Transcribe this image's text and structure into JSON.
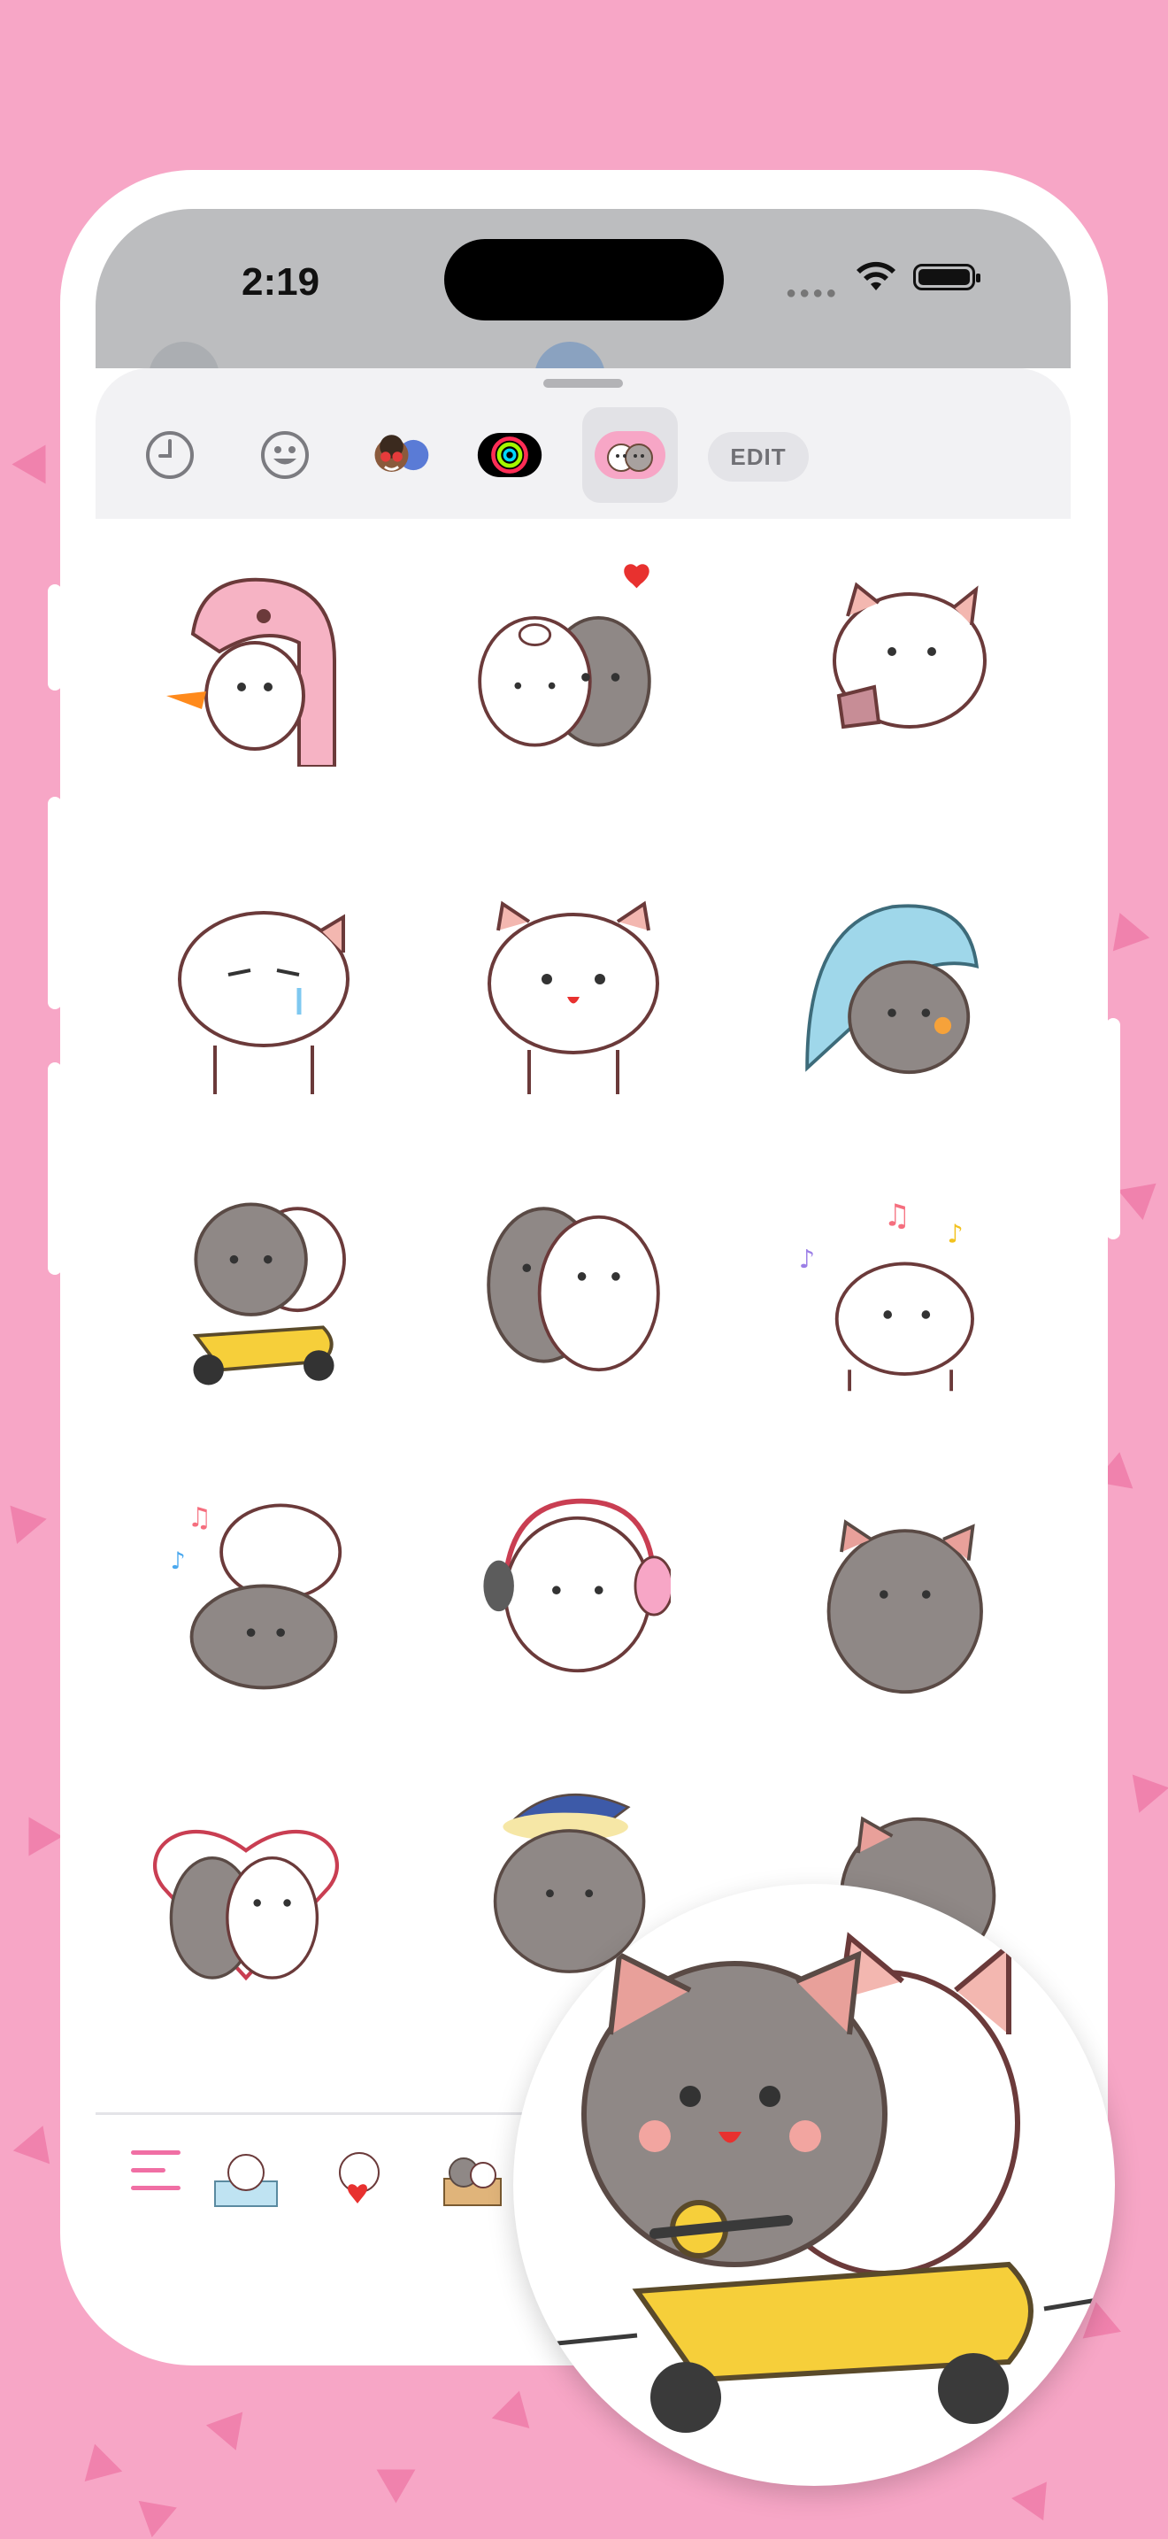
{
  "status_bar": {
    "time": "2:19",
    "signal_icon": "cellular-dots-icon",
    "wifi_icon": "wifi-icon",
    "battery_icon": "battery-icon"
  },
  "sheet": {
    "tabs": [
      {
        "name": "recent",
        "icon": "clock-icon"
      },
      {
        "name": "emoji",
        "icon": "smiley-icon"
      },
      {
        "name": "memoji",
        "icon": "memoji-avatars-icon"
      },
      {
        "name": "activity",
        "icon": "activity-rings-icon"
      },
      {
        "name": "cat-stickers",
        "icon": "cat-sticker-pack-icon",
        "selected": true
      }
    ],
    "edit_label": "EDIT"
  },
  "stickers": [
    {
      "id": "pink-dino-cat-fire",
      "desc_icon": "cat-in-pink-dino-hat-breathing-fire"
    },
    {
      "id": "pig-hood-with-grey-cat",
      "desc_icon": "cats-hugging-heart"
    },
    {
      "id": "white-cat-drinking",
      "desc_icon": "white-cat-drinking"
    },
    {
      "id": "white-cat-crying",
      "desc_icon": "white-cat-crying"
    },
    {
      "id": "white-cat-smiling",
      "desc_icon": "white-cat-smiling"
    },
    {
      "id": "grey-cat-blue-dino",
      "desc_icon": "grey-cat-in-blue-dino-hat"
    },
    {
      "id": "cats-on-scooter",
      "desc_icon": "cats-riding-scooter"
    },
    {
      "id": "cats-hugging",
      "desc_icon": "cats-hugging"
    },
    {
      "id": "white-cat-music",
      "desc_icon": "white-cat-with-music-notes"
    },
    {
      "id": "cats-stacked-music",
      "desc_icon": "cats-stacked-music"
    },
    {
      "id": "white-cat-headphones",
      "desc_icon": "white-cat-with-headphones"
    },
    {
      "id": "grey-cat-waving",
      "desc_icon": "grey-cat-waving"
    },
    {
      "id": "cats-heart-outline",
      "desc_icon": "cats-in-heart"
    },
    {
      "id": "grey-cat-sleep-cap",
      "desc_icon": "grey-cat-sleep-cap"
    },
    {
      "id": "grey-cat-peeking",
      "desc_icon": "grey-cat-peeking"
    }
  ],
  "bottom_bar": {
    "menu_icon": "hamburger-menu-icon",
    "packs": [
      "cat-pack-1",
      "cat-pack-2",
      "cat-pack-3"
    ]
  },
  "zoom_preview": {
    "icon": "cats-riding-scooter-enlarged"
  },
  "colors": {
    "background": "#f7a6c6",
    "accent_pink": "#f06fa4",
    "scooter_yellow": "#f6cf3a",
    "grey_cat": "#8f8886"
  }
}
